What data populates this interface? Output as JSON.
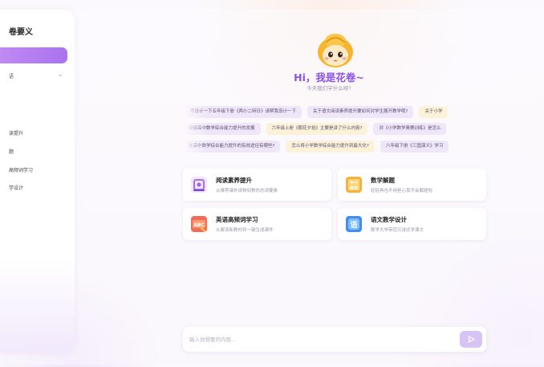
{
  "sidebar": {
    "title": "卷要义",
    "new_button_label": "",
    "selector_label": "语",
    "items": [
      {
        "label": "读提升"
      },
      {
        "label": "题"
      },
      {
        "label": "高频词学习"
      },
      {
        "label": "学设计"
      }
    ]
  },
  "greeting": {
    "title": "Hi，我是花卷~",
    "subtitle": "今天我们学什么呀?"
  },
  "suggestions": {
    "row1": [
      "写设计一下五年级下册《两小二辩日》请帮我设计一下",
      "关于语文阅读素养提升要如何对学生展开教学呢?",
      "关于小学"
    ],
    "row2": [
      "初级高中数学综合能力提升的发展",
      "六年级上册《朝花夕拾》主要是讲了什么内容?",
      "对《小学数学奥赛训练》是怎么"
    ],
    "row3": [
      "在高中数学综合能力提升的有效途径有哪些?",
      "怎么将小学数学综合能力提升到最大化?",
      "八年级下册《三国演义》学习"
    ]
  },
  "cards": [
    {
      "title": "阅读素养提升",
      "desc": "从推荐课外读物到教你总读要素",
      "icon": "reading-icon"
    },
    {
      "title": "数学解题",
      "desc": "轻轻再也不用担心我不会解题啦",
      "icon": "math-icon"
    },
    {
      "title": "英语高频词学习",
      "desc": "从解读新教材到一键生成课件",
      "icon": "english-abc-icon"
    },
    {
      "title": "语文教学设计",
      "desc": "数学大学带您沉浸式学课文",
      "icon": "chinese-teaching-icon"
    }
  ],
  "input": {
    "placeholder": "输入你想要的内容...",
    "value": ""
  },
  "colors": {
    "accent": "#a972ef",
    "greeting": "#8a52e6",
    "chip_purple": "#efe6fa",
    "chip_yellow": "#fbf2d9",
    "send_button": "#d8c3f7"
  }
}
